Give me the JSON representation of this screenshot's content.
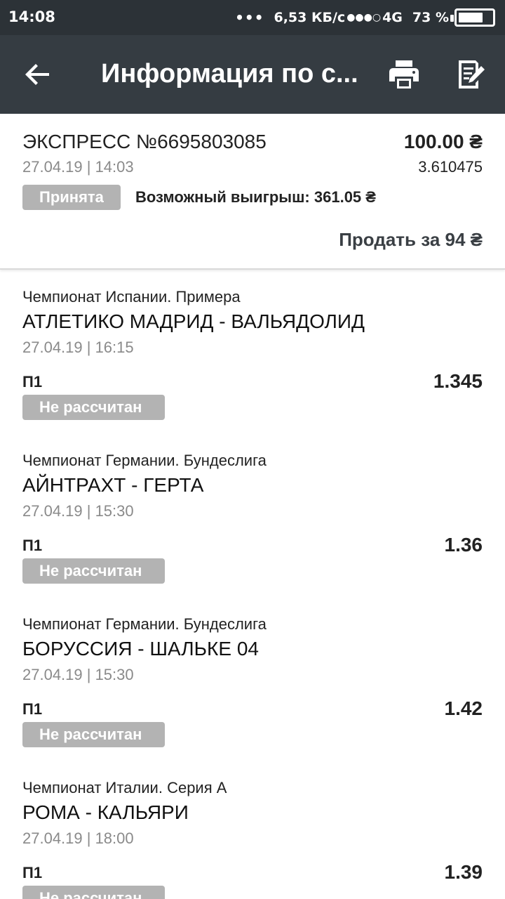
{
  "status_bar": {
    "time": "14:08",
    "dots": "•••",
    "speed": "6,53 КБ/с",
    "signal": "●●●○",
    "network": "4G",
    "battery_pct": "73 %",
    "battery_level": 0.73
  },
  "app_bar": {
    "title": "Информация по с...",
    "back_icon": "arrow-left-icon",
    "print_icon": "printer-icon",
    "edit_icon": "note-edit-icon"
  },
  "summary": {
    "title": "ЭКСПРЕСС №6695803085",
    "datetime": "27.04.19 | 14:03",
    "stake": "100.00 ₴",
    "coefficient": "3.610475",
    "status": "Принята",
    "possible_win": "Возможный выигрыш: 361.05 ₴",
    "sell_label": "Продать за 94 ₴"
  },
  "events": [
    {
      "league": "Чемпионат Испании. Примера",
      "match": "АТЛЕТИКО МАДРИД - ВАЛЬЯДОЛИД",
      "datetime": "27.04.19 | 16:15",
      "market": "П1",
      "odds": "1.345",
      "status": "Не рассчитан"
    },
    {
      "league": "Чемпионат Германии. Бундеслига",
      "match": "АЙНТРАХТ - ГЕРТА",
      "datetime": "27.04.19 | 15:30",
      "market": "П1",
      "odds": "1.36",
      "status": "Не рассчитан"
    },
    {
      "league": "Чемпионат Германии. Бундеслига",
      "match": "БОРУССИЯ - ШАЛЬКЕ 04",
      "datetime": "27.04.19 | 15:30",
      "market": "П1",
      "odds": "1.42",
      "status": "Не рассчитан"
    },
    {
      "league": "Чемпионат Италии. Серия А",
      "match": "РОМА - КАЛЬЯРИ",
      "datetime": "27.04.19 | 18:00",
      "market": "П1",
      "odds": "1.39",
      "status": "Не рассчитан"
    }
  ],
  "colors": {
    "status_bar_bg": "#2c3237",
    "app_bar_bg": "#353c42",
    "badge_bg": "#b3b3b3",
    "muted_text": "#8a8a8a"
  }
}
